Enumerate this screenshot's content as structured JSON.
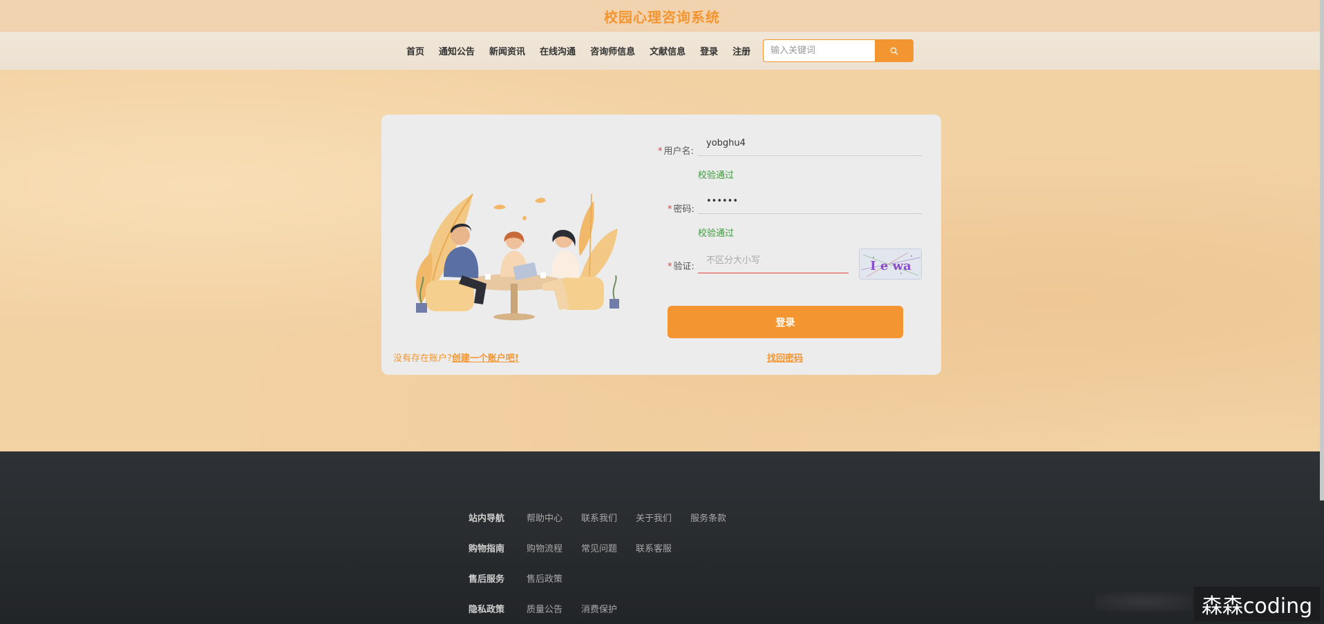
{
  "header": {
    "title": "校园心理咨询系统"
  },
  "nav": {
    "items": [
      "首页",
      "通知公告",
      "新闻资讯",
      "在线沟通",
      "咨询师信息",
      "文献信息",
      "登录",
      "注册"
    ],
    "search_placeholder": "输入关键词"
  },
  "login": {
    "username_label": "用户名:",
    "username_value": "yobghu4",
    "username_status": "校验通过",
    "password_label": "密码:",
    "password_value": "••••••",
    "password_status": "校验通过",
    "captcha_label": "验证:",
    "captcha_placeholder": "不区分大小写",
    "captcha_text": "I e wa",
    "submit_label": "登录",
    "no_account_text": "没有存在账户?",
    "create_account_link": "创建一个账户吧!",
    "forgot_password_link": "找回密码",
    "required_mark": "*"
  },
  "footer": {
    "rows": [
      {
        "head": "站内导航",
        "links": [
          "帮助中心",
          "联系我们",
          "关于我们",
          "服务条款"
        ]
      },
      {
        "head": "购物指南",
        "links": [
          "购物流程",
          "常见问题",
          "联系客服"
        ]
      },
      {
        "head": "售后服务",
        "links": [
          "售后政策"
        ]
      },
      {
        "head": "隐私政策",
        "links": [
          "质量公告",
          "消费保护"
        ]
      }
    ]
  },
  "watermark": "森森coding",
  "colors": {
    "accent": "#f39530",
    "valid": "#3b9d3b",
    "error": "#e53e3e",
    "footer_bg": "#2a2d31"
  }
}
